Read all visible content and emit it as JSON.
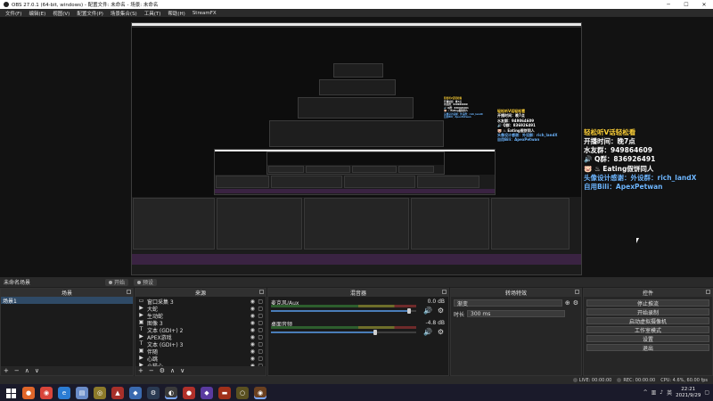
{
  "window": {
    "title": "OBS 27.0.1 (64-bit, windows) - 配置文件: 未命名 - 场景: 未命名",
    "minimize": "─",
    "maximize": "☐",
    "close": "✕"
  },
  "menu": [
    "文件(F)",
    "编辑(E)",
    "视图(V)",
    "配置文件(P)",
    "场景集合(S)",
    "工具(T)",
    "帮助(H)",
    "StreamFX"
  ],
  "overlay": {
    "lines": [
      {
        "text": "轻松听V话轻松看",
        "color": "yellow"
      },
      {
        "text": "开播时间：晚7点",
        "color": "white"
      },
      {
        "text": "水友群：949864609",
        "color": "white"
      },
      {
        "text": "🔊 Q群：836926491",
        "color": "white"
      },
      {
        "text": "🐷 ♨ Eating假饼同人",
        "color": "white"
      },
      {
        "text": "头像设计感谢：外设群：rich_landX",
        "color": "blue"
      },
      {
        "text": "自用Bili：ApexPetwan",
        "color": "blue"
      }
    ]
  },
  "scene_tabs": {
    "current": "未命名场景",
    "tabs": [
      "开始",
      "预设"
    ]
  },
  "docks": {
    "scenes": {
      "title": "场景",
      "items": [
        "场景1"
      ],
      "footer": [
        "+",
        "−",
        "∧",
        "∨"
      ]
    },
    "sources": {
      "title": "来源",
      "items": [
        {
          "icon": "▭",
          "label": "窗口采集 3"
        },
        {
          "icon": "▶",
          "label": "大蛇"
        },
        {
          "icon": "▶",
          "label": "生动蛇"
        },
        {
          "icon": "▣",
          "label": "图像 3"
        },
        {
          "icon": "T",
          "label": "文本 (GDI+) 2"
        },
        {
          "icon": "▶",
          "label": "APEX游戏"
        },
        {
          "icon": "T",
          "label": "文本 (GDI+) 3"
        },
        {
          "icon": "▣",
          "label": "伴随"
        },
        {
          "icon": "▶",
          "label": "心跳"
        },
        {
          "icon": "▶",
          "label": "小猫心"
        }
      ],
      "footer": [
        "+",
        "−",
        "⚙",
        "∧",
        "∨"
      ]
    },
    "mixer": {
      "title": "混音器",
      "channels": [
        {
          "name": "麦克风/Aux",
          "db": "0.0 dB",
          "level": 0.95
        },
        {
          "name": "桌面音频",
          "db": "-4.8 dB",
          "level": 0.72
        }
      ]
    },
    "transitions": {
      "title": "转场特效",
      "type_label": "渐变",
      "duration_label": "时长",
      "duration_value": "300 ms"
    },
    "controls": {
      "title": "控件",
      "buttons": [
        "停止推流",
        "开始录制",
        "启动虚拟摄像机",
        "工作室模式",
        "设置",
        "退出"
      ]
    }
  },
  "status": {
    "live": "LIVE: 00:00:00",
    "rec": "REC: 00:00:00",
    "cpu": "CPU: 4.6%, 60.00 fps"
  },
  "taskbar": {
    "time": "22:21",
    "date": "2021/9/29",
    "lang": "英"
  },
  "colors": {
    "accent": "#4a7db8",
    "overlay_yellow": "#ffd23a",
    "overlay_blue": "#6fb7ff",
    "purple_strip": "#3a2342"
  }
}
